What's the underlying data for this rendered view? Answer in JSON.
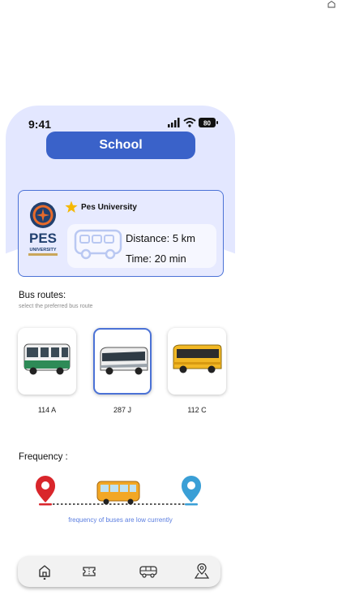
{
  "status_bar": {
    "time": "9:41",
    "battery": "80"
  },
  "header": {
    "destination_button": "School"
  },
  "destination_card": {
    "name": "Pes University",
    "logo": {
      "line1": "PES",
      "line2": "UNIVERSITY"
    },
    "distance_label": "Distance:",
    "distance_value": "5 km",
    "time_label": "Time:",
    "time_value": "20 min"
  },
  "routes": {
    "title": "Bus routes:",
    "subtitle": "select the preferred bus route",
    "items": [
      {
        "label": "114 A",
        "selected": false,
        "bus_color": "#2e8b57"
      },
      {
        "label": "287 J",
        "selected": true,
        "bus_color": "#e8e8e8"
      },
      {
        "label": "112 C",
        "selected": false,
        "bus_color": "#f2b824"
      }
    ]
  },
  "frequency": {
    "title": "Frequency :",
    "note": "frequency of buses are low currently"
  },
  "nav": {
    "items": [
      "home-icon",
      "ticket-icon",
      "bus-icon",
      "map-pin-icon"
    ],
    "active": "home-icon"
  },
  "colors": {
    "accent": "#3a62c9",
    "hero_bg": "#e3e7ff",
    "start_pin": "#d9262b",
    "end_pin": "#3a9fd6"
  }
}
